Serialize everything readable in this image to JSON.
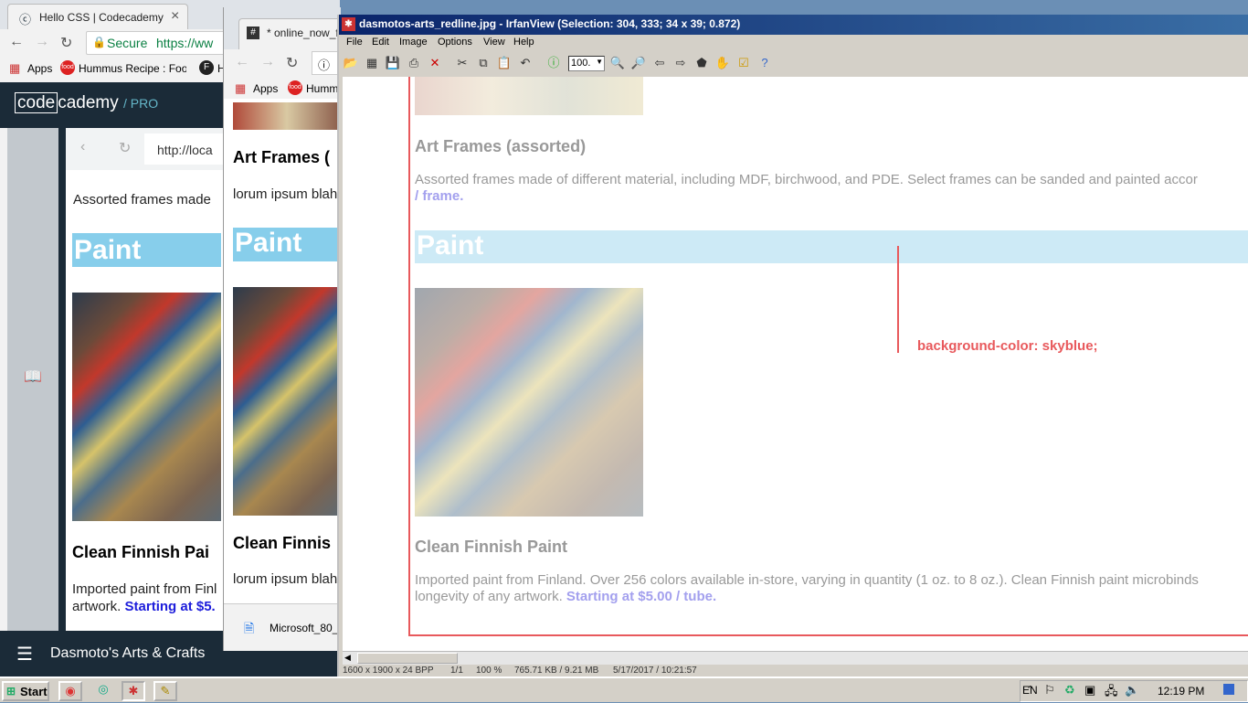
{
  "chrome1": {
    "tab_title": "Hello CSS | Codecademy",
    "tab_close": "×",
    "secure_label": "Secure",
    "url": "https://ww",
    "bookmarks": [
      "Apps",
      "Hummus Recipe : Food N",
      "H"
    ],
    "logo_code": "code",
    "logo_cademy": "cademy",
    "logo_pro": "/ PRO",
    "inner_url": "http://loca",
    "frames_text": "Assorted frames made",
    "paint_heading": "Paint",
    "product_title": "Clean Finnish Pai",
    "product_text": "Imported paint from Finl",
    "product_text2": "artwork.",
    "product_price": "Starting at $5.",
    "footer_title": "Dasmoto's Arts & Crafts"
  },
  "chrome2": {
    "tab_title": "* online_now_fv",
    "bookmarks": [
      "Apps",
      "Hummu"
    ],
    "frames_title": "Art Frames (",
    "frames_text": "lorum ipsum blah",
    "paint_heading": "Paint",
    "product_title": "Clean Finnis",
    "product_text": "lorum ipsum blah",
    "download_item": "Microsoft_80_"
  },
  "irfan": {
    "title": "dasmotos-arts_redline.jpg - IrfanView (Selection: 304, 333; 34 x 39; 0.872)",
    "menus": [
      "File",
      "Edit",
      "Image",
      "Options",
      "View",
      "Help"
    ],
    "zoom_value": "100.",
    "frames_title": "Art Frames (assorted)",
    "frames_text": "Assorted frames made of different material, including MDF, birchwood, and PDE. Select frames can be sanded and painted accor",
    "frames_price": "/ frame.",
    "paint_heading": "Paint",
    "annotation": "background-color: skyblue;",
    "product_title": "Clean Finnish Paint",
    "product_text": "Imported paint from Finland. Over 256 colors available in-store, varying in quantity (1 oz. to 8 oz.). Clean Finnish paint microbinds",
    "product_text2": "longevity of any artwork.",
    "product_price": "Starting at $5.00 / tube.",
    "status": [
      "1600 x 1900 x 24 BPP",
      "1/1",
      "100 %",
      "765.71 KB / 9.21 MB",
      "5/17/2017 / 10:21:57"
    ]
  },
  "taskbar": {
    "start_label": "Start",
    "lang": "EN",
    "clock": "12:19 PM"
  },
  "colors": {
    "skyblue": "#87ceeb",
    "codecademy_navy": "#1b2b38",
    "redline": "#e8595c",
    "link_blue": "#1d1ddb"
  }
}
